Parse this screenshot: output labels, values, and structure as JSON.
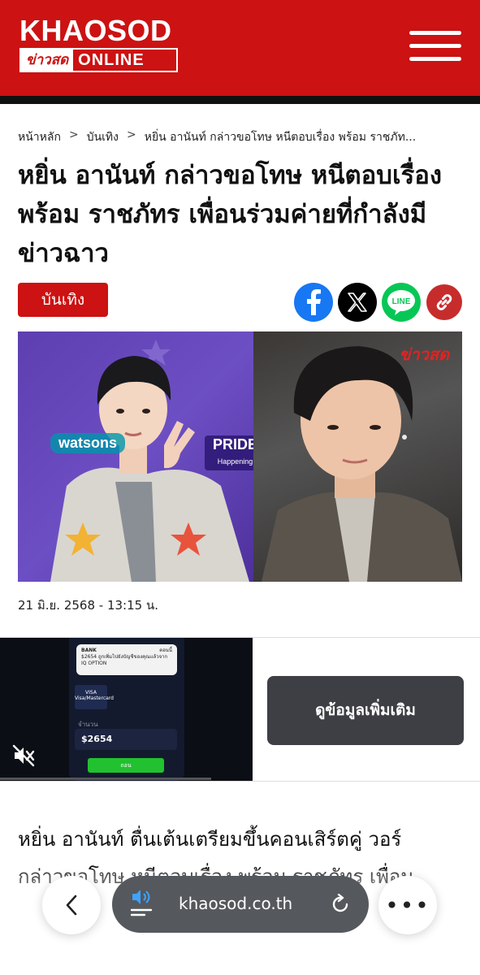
{
  "header": {
    "logo_main": "KHAOSOD",
    "logo_thai": "ข่าวสด",
    "logo_online": "ONLINE",
    "menu_icon": "hamburger-menu-icon"
  },
  "breadcrumb": {
    "home": "หน้าหลัก",
    "section": "บันเทิง",
    "current": "หยิ่น อานันท์ กล่าวขอโทษ หนีตอบเรื่อง พร้อม ราชภัท...",
    "separator": ">"
  },
  "article": {
    "title": "หยิ่น อานันท์ กล่าวขอโทษ หนีตอบเรื่อง พร้อม ราชภัทร เพื่อนร่วมค่ายที่กำลังมีข่าวฉาว",
    "category": "บันเทิง",
    "date": "21 มิ.ย. 2568 - 13:15 น.",
    "body_line1": "หยิ่น อานันท์ ตื่นเต้นเตรียมขึ้นคอนเสิร์ตคู่ วอร์",
    "body_line2": "กล่าวขอโทษ หนีตอบเรื่อง พร้อม ราชภัทร เพื่อน"
  },
  "share": {
    "facebook_icon": "facebook-icon",
    "x_icon": "x-icon",
    "line_icon": "line-icon",
    "line_label": "LINE",
    "link_icon": "link-icon"
  },
  "hero": {
    "watermark": "ข่าวสด",
    "brand_text": "watsons",
    "pride_text": "PRIDE",
    "pride_sub": "Happening"
  },
  "ad": {
    "notif_bank": "BANK",
    "notif_time": "ตอนนี้",
    "notif_body": "$2654 ถูกเพิ่มไปยังบัญชีของคุณแล้วจาก IQ OPTION",
    "visa_label": "VISA Visa/Mastercard",
    "amount_label": "จำนวน",
    "amount_value": "$2654",
    "green_button": "ถอน",
    "cta": "ดูข้อมูลเพิ่มเติม",
    "mute_icon": "speaker-muted-icon"
  },
  "browser": {
    "url": "khaosod.co.th",
    "back_icon": "chevron-left-icon",
    "reader_icon": "reader-audio-icon",
    "reload_icon": "reload-icon",
    "more_icon": "more-icon",
    "more_label": "•••"
  },
  "colors": {
    "brand_red": "#cc1212",
    "facebook_blue": "#1877f2",
    "line_green": "#06c755",
    "link_red": "#c72c2c"
  }
}
